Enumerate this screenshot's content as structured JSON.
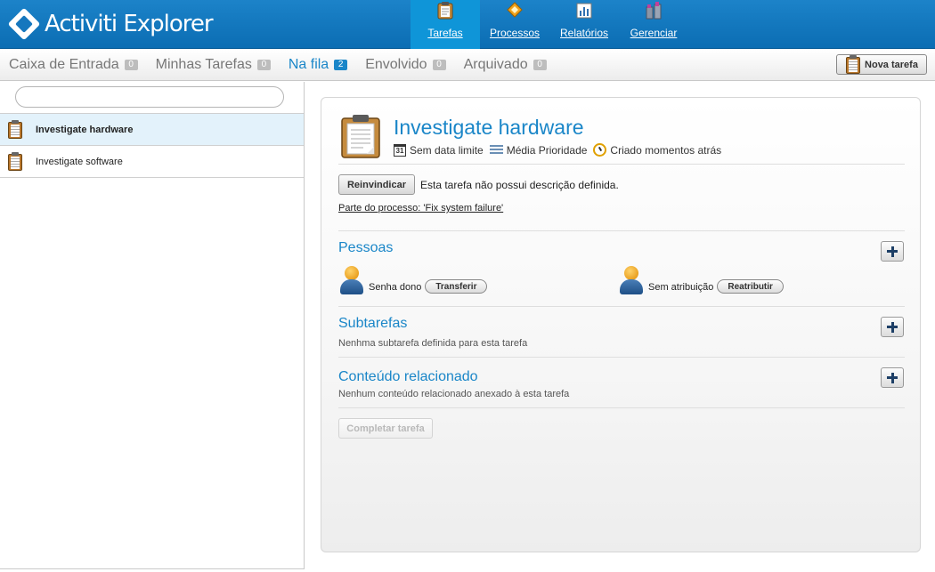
{
  "app": {
    "title": "Activiti Explorer"
  },
  "main_nav": [
    {
      "label": "Tarefas",
      "icon": "clipboard-icon",
      "active": true
    },
    {
      "label": "Processos",
      "icon": "diamond-icon",
      "active": false
    },
    {
      "label": "Relatórios",
      "icon": "chart-icon",
      "active": false
    },
    {
      "label": "Gerenciar",
      "icon": "people-icon",
      "active": false
    }
  ],
  "tabs": [
    {
      "label": "Caixa de Entrada",
      "count": "0",
      "active": false
    },
    {
      "label": "Minhas Tarefas",
      "count": "0",
      "active": false
    },
    {
      "label": "Na fila",
      "count": "2",
      "active": true
    },
    {
      "label": "Envolvido",
      "count": "0",
      "active": false
    },
    {
      "label": "Arquivado",
      "count": "0",
      "active": false
    }
  ],
  "toolbar": {
    "new_task_label": "Nova tarefa"
  },
  "search": {
    "value": "",
    "placeholder": ""
  },
  "tasks": [
    {
      "name": "Investigate hardware",
      "selected": true
    },
    {
      "name": "Investigate software",
      "selected": false
    }
  ],
  "task_detail": {
    "title": "Investigate hardware",
    "due": "Sem data limite",
    "priority": "Média Prioridade",
    "created": "Criado momentos atrás",
    "claim_label": "Reinvindicar",
    "description": "Esta tarefa não possui descrição definida.",
    "process_link": "Parte do processo: 'Fix system failure'",
    "people": {
      "title": "Pessoas",
      "owner_label": "Senha dono",
      "transfer_label": "Transferir",
      "assignee_label": "Sem atribuição",
      "reassign_label": "Reatributir"
    },
    "subtasks": {
      "title": "Subtarefas",
      "empty": "Nenhma subtarefa definida para esta tarefa"
    },
    "related": {
      "title": "Conteúdo relacionado",
      "empty": "Nenhum conteúdo relacionado anexado à esta tarefa"
    },
    "complete_label": "Completar tarefa"
  },
  "colors": {
    "header": "#0b6db3",
    "accent": "#1a86c8",
    "active_nav": "#0f95d8",
    "selected_row": "#e3f2fb"
  }
}
